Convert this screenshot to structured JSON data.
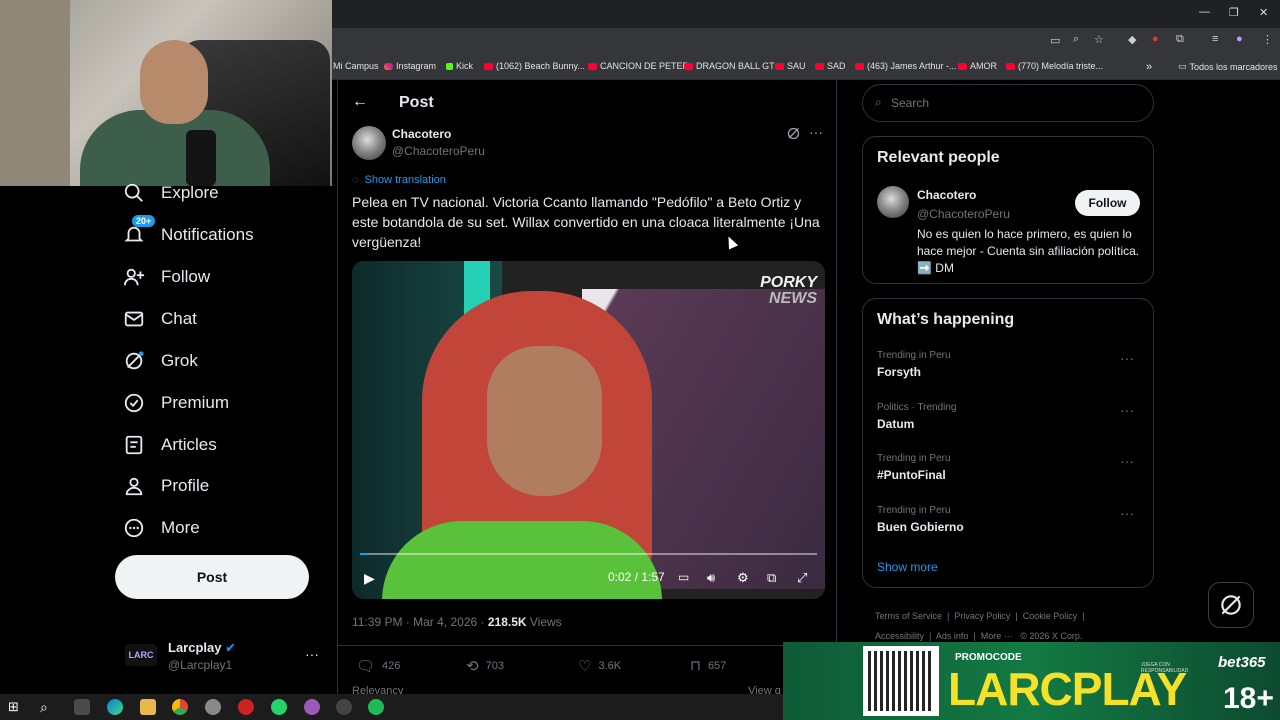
{
  "browser": {
    "bookmarks": [
      {
        "label": "Mi Campus",
        "icon": "none"
      },
      {
        "label": "Instagram",
        "icon": "instagram-icon"
      },
      {
        "label": "Kick",
        "icon": "kick-icon"
      },
      {
        "label": "(1062) Beach Bunny...",
        "icon": "youtube-icon"
      },
      {
        "label": "CANCION DE PETER",
        "icon": "youtube-icon"
      },
      {
        "label": "DRAGON BALL GT",
        "icon": "youtube-icon"
      },
      {
        "label": "SAU",
        "icon": "youtube-icon"
      },
      {
        "label": "SAD",
        "icon": "youtube-icon"
      },
      {
        "label": "(463) James Arthur -...",
        "icon": "youtube-icon"
      },
      {
        "label": "AMOR",
        "icon": "youtube-icon"
      },
      {
        "label": "(770) Melodía triste...",
        "icon": "youtube-icon"
      }
    ],
    "all_bookmarks": "Todos los marcadores"
  },
  "nav": {
    "items": [
      {
        "label": "Explore"
      },
      {
        "label": "Notifications",
        "badge": "20+"
      },
      {
        "label": "Follow"
      },
      {
        "label": "Chat"
      },
      {
        "label": "Grok"
      },
      {
        "label": "Premium"
      },
      {
        "label": "Articles"
      },
      {
        "label": "Profile"
      },
      {
        "label": "More"
      }
    ],
    "post_button": "Post",
    "account": {
      "name": "Larcplay",
      "handle": "@Larcplay1",
      "more": "···"
    }
  },
  "main": {
    "header_title": "Post",
    "author": {
      "name": "Chacotero",
      "handle": "@ChacoteroPeru"
    },
    "show_translation": "Show translation",
    "text": "Pelea en TV nacional. Victoria Ccanto llamando \"Pedófilo\" a Beto Ortiz y este botandola de su set. Willax convertido en una cloaca literalmente ¡Una vergüenza!",
    "video": {
      "logo_line1": "PORKY",
      "logo_line2": "NEWS",
      "time": "0:02 / 1:57",
      "progress": 0.017
    },
    "timestamp": "11:39 PM · Mar 4, 2026 · ",
    "views_count": "218.5K",
    "views_label": " Views",
    "actions": {
      "replies": "426",
      "reposts": "703",
      "likes": "3.6K",
      "bookmarks": "657"
    },
    "relevancy": "Relevancy",
    "view_quotes": "View q"
  },
  "sidebar": {
    "search_placeholder": "Search",
    "relevant": {
      "title": "Relevant people",
      "name": "Chacotero",
      "handle": "@ChacoteroPeru",
      "follow_label": "Follow",
      "bio": "No es quien lo hace primero, es quien lo hace mejor - Cuenta sin afiliación política. ➡️ DM"
    },
    "happening": {
      "title": "What’s happening",
      "trends": [
        {
          "category": "Trending in Peru",
          "name": "Forsyth"
        },
        {
          "category": "Politics · Trending",
          "name": "Datum"
        },
        {
          "category": "Trending in Peru",
          "name": "#PuntoFinal"
        },
        {
          "category": "Trending in Peru",
          "name": "Buen Gobierno"
        }
      ],
      "show_more": "Show more"
    },
    "footer": {
      "line1": [
        "Terms of Service",
        "Privacy Policy",
        "Cookie Policy"
      ],
      "line2": [
        "Accessibility",
        "Ads info",
        "More ···",
        "© 2026 X Corp."
      ]
    }
  },
  "ad": {
    "promocode": "PROMOCODE",
    "brand": "LARCPLAY",
    "sponsor": "bet365",
    "age": "18+",
    "small_text": "JUEGA CON RESPONSABILIDAD"
  },
  "colors": {
    "accent": "#1d9bf0",
    "background": "#000000",
    "border": "#2f3336",
    "muted": "#71767b",
    "ad_green": "#137a43",
    "ad_yellow": "#f5e12a"
  }
}
